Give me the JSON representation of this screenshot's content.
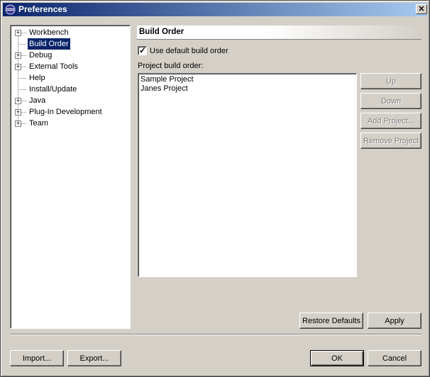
{
  "window": {
    "title": "Preferences",
    "close_label": "✕"
  },
  "tree": {
    "items": [
      {
        "label": "Workbench",
        "expandable": true
      },
      {
        "label": "Build Order",
        "expandable": false,
        "selected": true
      },
      {
        "label": "Debug",
        "expandable": true
      },
      {
        "label": "External Tools",
        "expandable": true
      },
      {
        "label": "Help",
        "expandable": false
      },
      {
        "label": "Install/Update",
        "expandable": false
      },
      {
        "label": "Java",
        "expandable": true
      },
      {
        "label": "Plug-In Development",
        "expandable": true
      },
      {
        "label": "Team",
        "expandable": true
      }
    ]
  },
  "page": {
    "title": "Build Order",
    "use_default_label": "Use default build order",
    "use_default_checked": true,
    "list_label": "Project build order:",
    "projects": [
      "Sample Project",
      "Janes Project"
    ],
    "side_buttons": {
      "up": "Up",
      "down": "Down",
      "add_project": "Add Project...",
      "remove_project": "Remove Project"
    },
    "restore_defaults": "Restore Defaults",
    "apply": "Apply"
  },
  "footer": {
    "import": "Import...",
    "export": "Export...",
    "ok": "OK",
    "cancel": "Cancel"
  }
}
